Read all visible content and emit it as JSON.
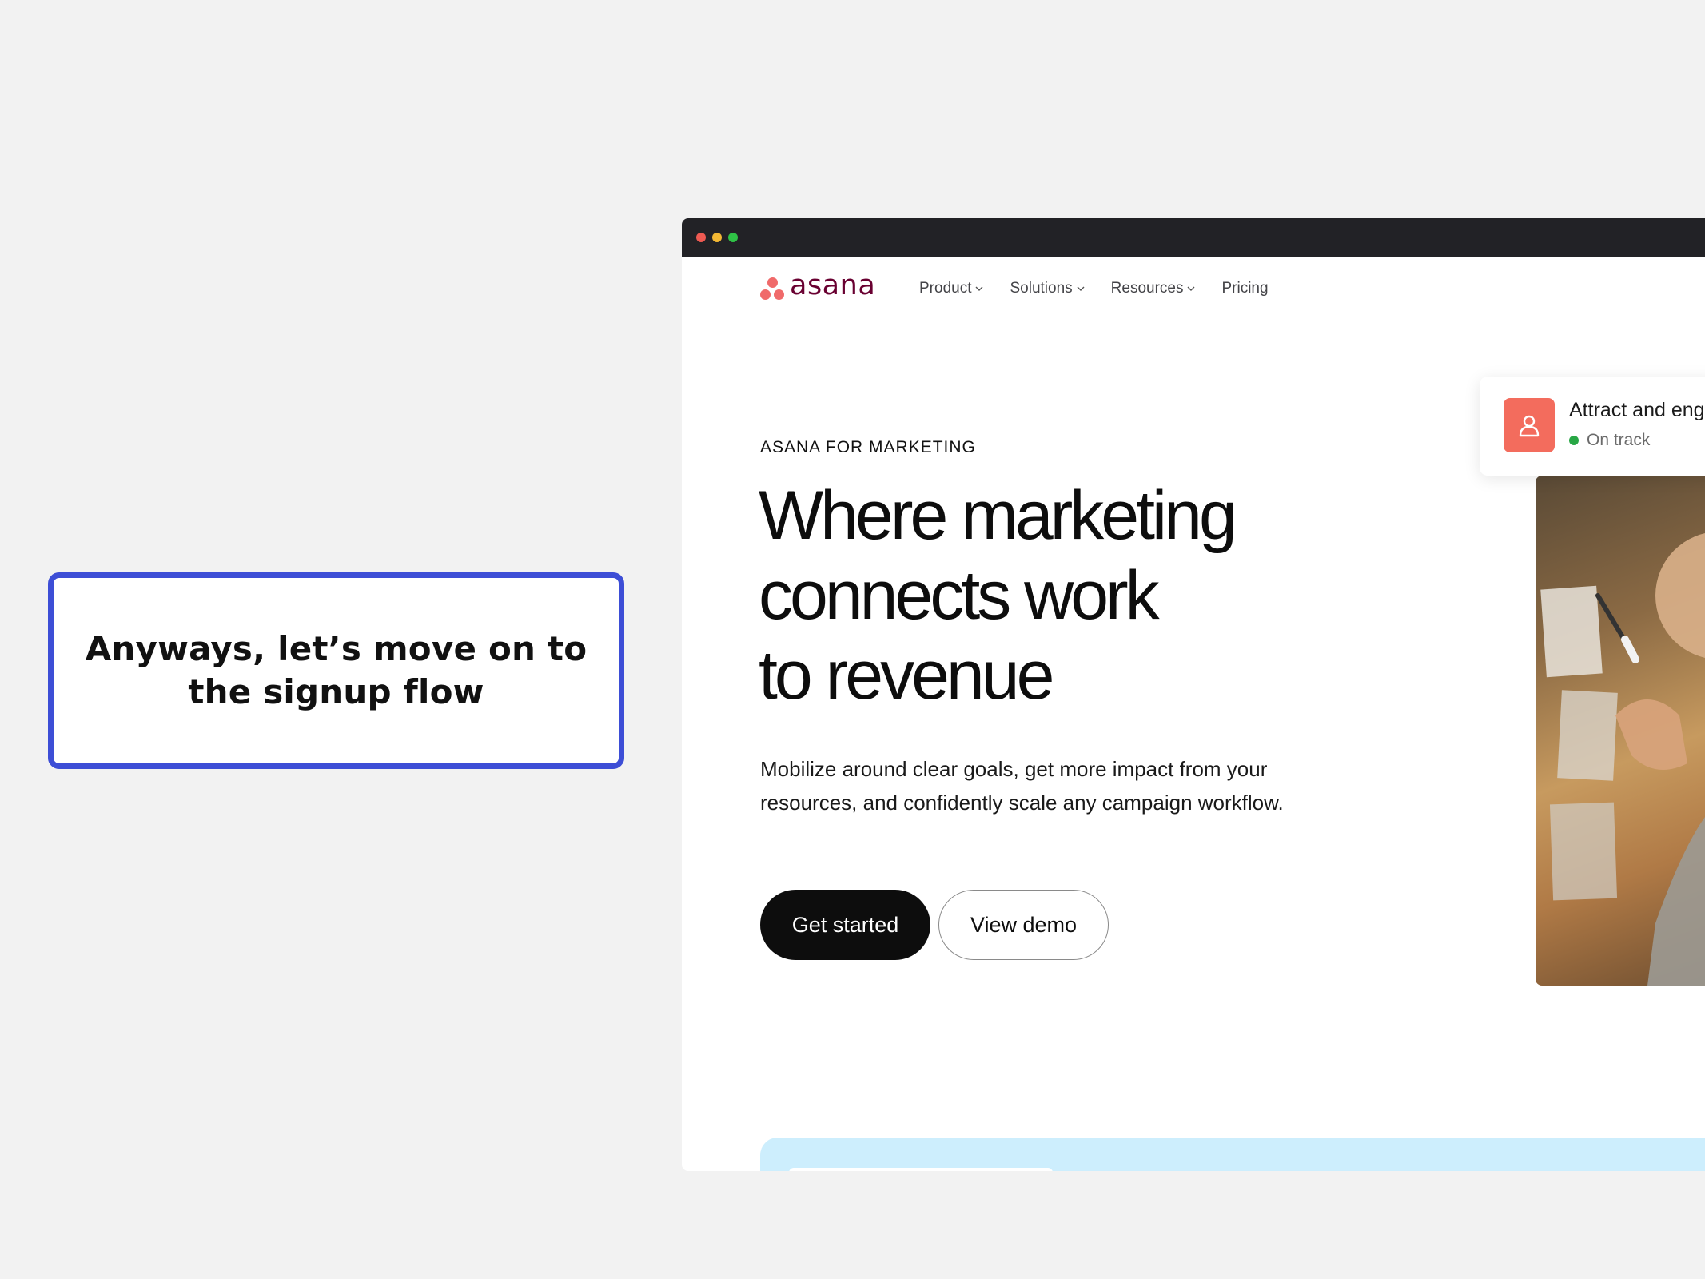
{
  "caption": {
    "text": "Anyways, let’s move on to the signup flow"
  },
  "browser": {
    "logo_text": "asana",
    "nav": [
      {
        "label": "Product",
        "has_dropdown": true
      },
      {
        "label": "Solutions",
        "has_dropdown": true
      },
      {
        "label": "Resources",
        "has_dropdown": true
      },
      {
        "label": "Pricing",
        "has_dropdown": false
      }
    ],
    "hero": {
      "eyebrow": "ASANA FOR MARKETING",
      "headline_lines": [
        "Where marketing",
        "connects work",
        "to revenue"
      ],
      "subtext": "Mobilize around clear goals, get more impact from your resources, and confidently scale any campaign workflow.",
      "primary_button": "Get started",
      "secondary_button": "View demo"
    },
    "status_card": {
      "title": "Attract and eng",
      "status": "On track",
      "status_color": "#28a745",
      "icon": "user-icon"
    }
  },
  "colors": {
    "accent": "#3d4ed6",
    "brand": "#f06a6a",
    "logo_text": "#690031"
  }
}
